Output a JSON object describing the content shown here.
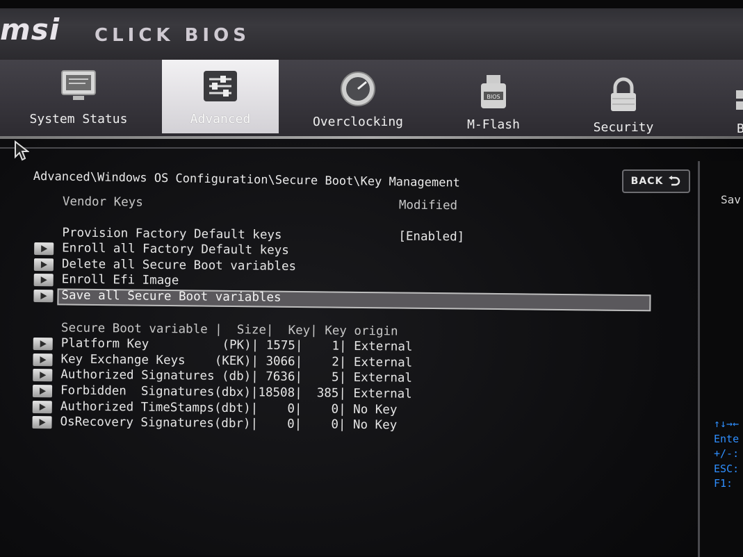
{
  "brand": {
    "logo": "msi",
    "product": "CLICK BIOS"
  },
  "tabs": [
    {
      "label": "System Status",
      "icon": "monitor-icon",
      "active": false
    },
    {
      "label": "Advanced",
      "icon": "sliders-icon",
      "active": true
    },
    {
      "label": "Overclocking",
      "icon": "gauge-icon",
      "active": false
    },
    {
      "label": "M-Flash",
      "icon": "usb-drive-icon",
      "active": false
    },
    {
      "label": "Security",
      "icon": "padlock-icon",
      "active": false
    },
    {
      "label": "B",
      "icon": "boot-icon",
      "active": false
    }
  ],
  "breadcrumb": "Advanced\\Windows OS Configuration\\Secure Boot\\Key Management",
  "back_button": {
    "label": "BACK",
    "icon": "back-arrow-icon"
  },
  "settings": {
    "vendor_keys": {
      "label": "Vendor Keys",
      "value": "Modified"
    },
    "provision": {
      "label": "Provision Factory Default keys",
      "value": "[Enabled]"
    },
    "actions": [
      "Enroll all Factory Default keys",
      "Delete all Secure Boot variables",
      "Enroll Efi Image",
      "Save all Secure Boot variables"
    ]
  },
  "var_table": {
    "header": "Secure Boot variable |  Size|  Key| Key origin",
    "rows": [
      "Platform Key          (PK)| 1575|    1| External",
      "Key Exchange Keys    (KEK)| 3066|    2| External",
      "Authorized Signatures (db)| 7636|    5| External",
      "Forbidden  Signatures(dbx)|18508|  385| External",
      "Authorized TimeStamps(dbt)|    0|    0| No Key",
      "OsRecovery Signatures(dbr)|    0|    0| No Key"
    ]
  },
  "help_panel": {
    "title": "Sav",
    "keys": [
      "↑↓→←",
      "Ente",
      "+/-:",
      "ESC:",
      "F1: "
    ]
  },
  "colors": {
    "accent_key_help": "#2f8fff",
    "active_tab": "#e6e4e8"
  }
}
